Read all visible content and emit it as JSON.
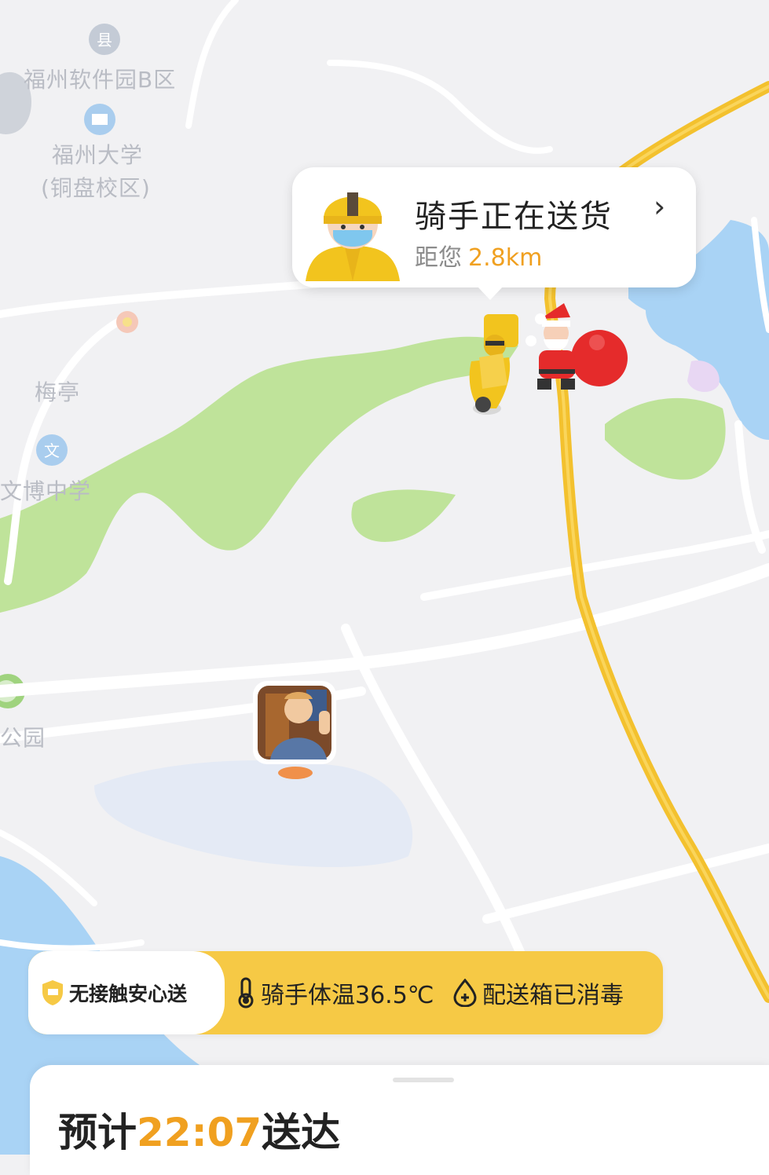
{
  "map": {
    "pois": [
      {
        "name": "福州软件园B区"
      },
      {
        "name": "福州大学"
      },
      {
        "name": "(铜盘校区)"
      },
      {
        "name": "梅亭"
      },
      {
        "name": "文博中学"
      },
      {
        "name": "公园"
      }
    ],
    "icons": {
      "park_icon": "map-pin-icon",
      "university_icon": "school-icon",
      "school_icon": "school-icon"
    },
    "colors": {
      "route": "#f3c12e",
      "green": "#bfe39a",
      "water": "#a9d3f5",
      "road": "#ffffff",
      "land": "#f1f1f3"
    }
  },
  "rider_bubble": {
    "title": "骑手正在送货",
    "distance_label": "距您",
    "distance_value": "2.8km",
    "chevron": "›"
  },
  "safety_bar": {
    "badge": "无接触安心送",
    "temperature": "骑手体温36.5℃",
    "disinfected": "配送箱已消毒"
  },
  "sheet": {
    "eta_prefix": "预计",
    "eta_time": "22:07",
    "eta_suffix": "送达"
  }
}
